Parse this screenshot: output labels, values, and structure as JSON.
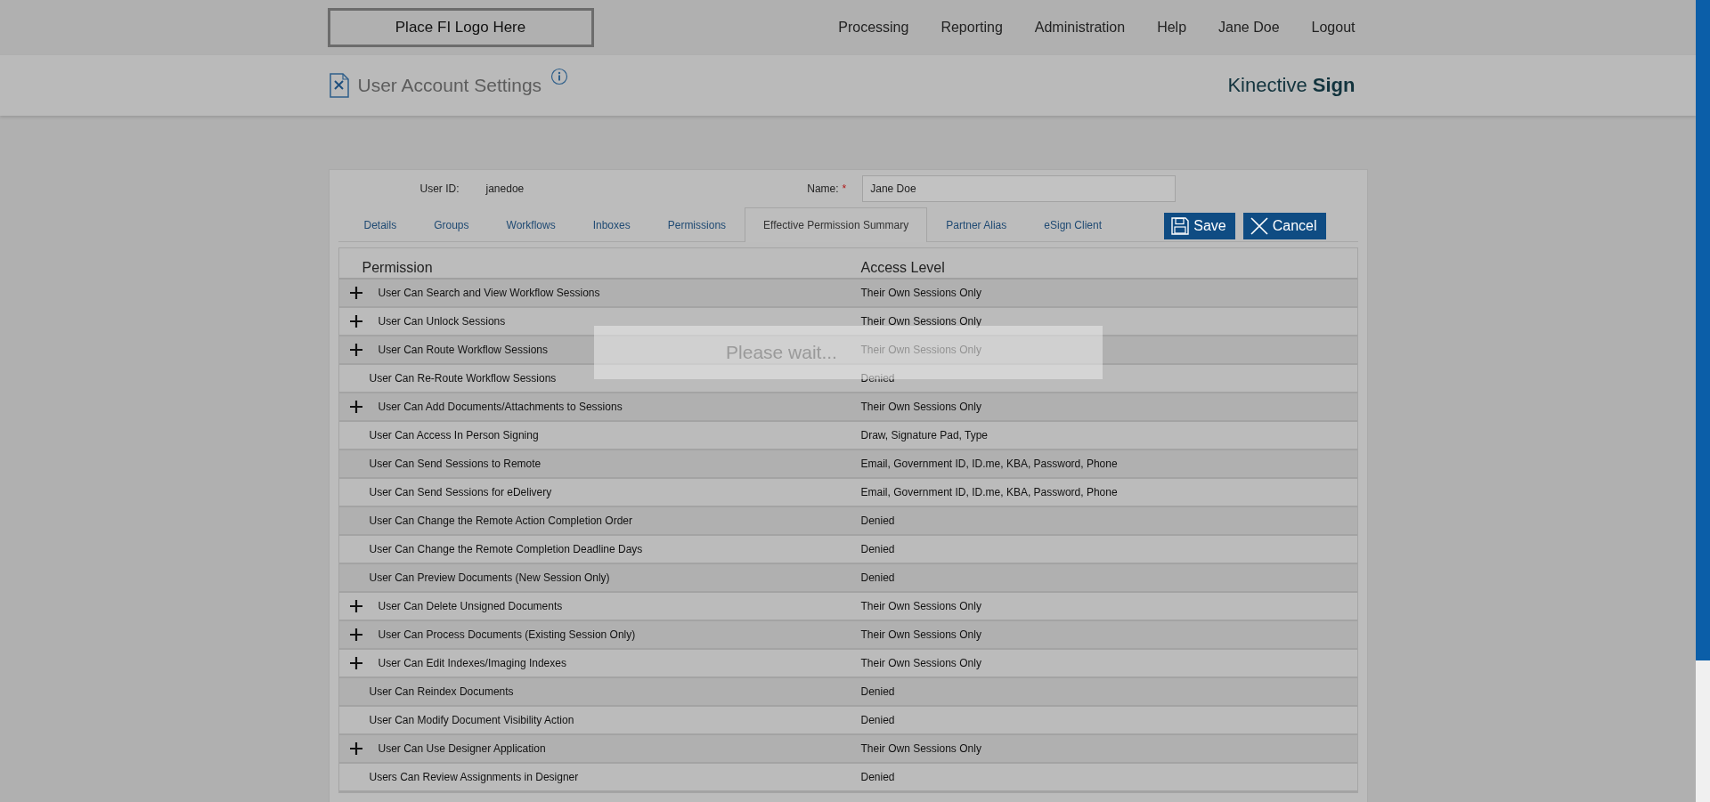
{
  "header": {
    "logo_placeholder": "Place FI Logo Here",
    "nav": [
      "Processing",
      "Reporting",
      "Administration",
      "Help",
      "Jane Doe",
      "Logout"
    ]
  },
  "page_header": {
    "title": "User Account Settings",
    "brand": "Kinective **Sign**"
  },
  "form": {
    "user_id_label": "User ID:",
    "user_id": "janedoe",
    "name_label": "Name:",
    "name_required": true,
    "required_mark": "*",
    "name_value": "Jane Doe"
  },
  "tabs": [
    {
      "label": "Details",
      "selected": false
    },
    {
      "label": "Groups",
      "selected": false
    },
    {
      "label": "Workflows",
      "selected": false
    },
    {
      "label": "Inboxes",
      "selected": false
    },
    {
      "label": "Permissions",
      "selected": false
    },
    {
      "label": "Effective Permission Summary",
      "selected": true
    },
    {
      "label": "Partner Alias",
      "selected": false
    },
    {
      "label": "eSign Client",
      "selected": false
    }
  ],
  "buttons": [
    {
      "kind": "save",
      "label": "Save"
    },
    {
      "kind": "cancel",
      "label": "Cancel"
    }
  ],
  "table": {
    "columns": [
      "Permission",
      "Access Level"
    ],
    "rows": [
      {
        "kind": "expandable",
        "permission": "User Can Search and View Workflow Sessions",
        "access": "Their Own Sessions Only"
      },
      {
        "kind": "expandable",
        "permission": "User Can Unlock Sessions",
        "access": "Their Own Sessions Only"
      },
      {
        "kind": "expandable",
        "permission": "User Can Route Workflow Sessions",
        "access": "Their Own Sessions Only"
      },
      {
        "kind": "plain",
        "permission": "User Can Re-Route Workflow Sessions",
        "access": "Denied"
      },
      {
        "kind": "expandable",
        "permission": "User Can Add Documents/Attachments to Sessions",
        "access": "Their Own Sessions Only"
      },
      {
        "kind": "plain",
        "permission": "User Can Access In Person Signing",
        "access": "Draw, Signature Pad, Type"
      },
      {
        "kind": "plain",
        "permission": "User Can Send Sessions to Remote",
        "access": "Email, Government ID, ID.me, KBA, Password, Phone"
      },
      {
        "kind": "plain",
        "permission": "User Can Send Sessions for eDelivery",
        "access": "Email, Government ID, ID.me, KBA, Password, Phone"
      },
      {
        "kind": "plain",
        "permission": "User Can Change the Remote Action Completion Order",
        "access": "Denied"
      },
      {
        "kind": "plain",
        "permission": "User Can Change the Remote Completion Deadline Days",
        "access": "Denied"
      },
      {
        "kind": "plain",
        "permission": "User Can Preview Documents (New Session Only)",
        "access": "Denied"
      },
      {
        "kind": "expandable",
        "permission": "User Can Delete Unsigned Documents",
        "access": "Their Own Sessions Only"
      },
      {
        "kind": "expandable",
        "permission": "User Can Process Documents (Existing Session Only)",
        "access": "Their Own Sessions Only"
      },
      {
        "kind": "expandable",
        "permission": "User Can Edit Indexes/Imaging Indexes",
        "access": "Their Own Sessions Only"
      },
      {
        "kind": "plain",
        "permission": "User Can Reindex Documents",
        "access": "Denied"
      },
      {
        "kind": "plain",
        "permission": "User Can Modify Document Visibility Action",
        "access": "Denied"
      },
      {
        "kind": "expandable",
        "permission": "User Can Use Designer Application",
        "access": "Their Own Sessions Only"
      },
      {
        "kind": "plain",
        "permission": "Users Can Review Assignments in Designer",
        "access": "Denied"
      }
    ]
  },
  "loading_message": "Please wait..."
}
